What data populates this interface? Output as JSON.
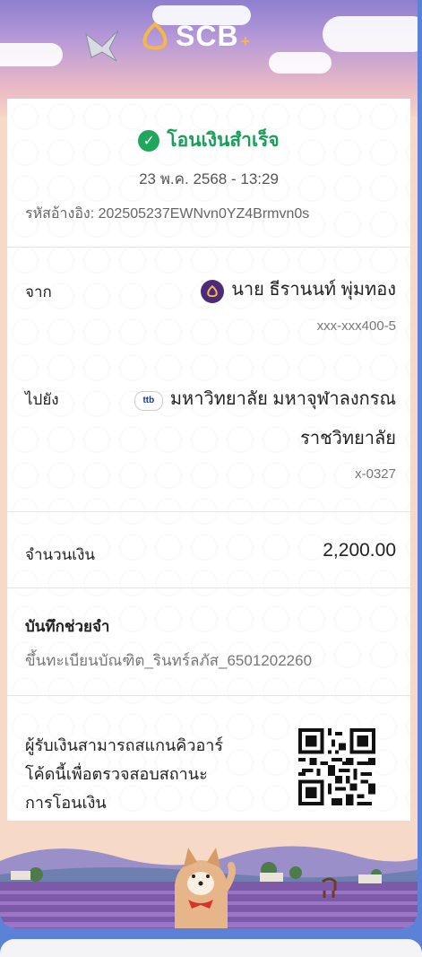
{
  "header": {
    "brand": "SCB",
    "brand_plus": "+",
    "icons": {
      "logo": "scb-logo-icon",
      "bird": "bird-illustration-icon"
    }
  },
  "status": {
    "text": "โอนเงินสำเร็จ",
    "icon": "check-circle-icon",
    "color": "#1fa75d"
  },
  "datetime": "23 พ.ค. 2568 - 13:29",
  "reference": "รหัสอ้างอิง: 202505237EWNvn0YZ4Brmvn0s",
  "from": {
    "label": "จาก",
    "name": "นาย ธีรานนท์ พุ่มทอง",
    "account": "xxx-xxx400-5",
    "bank_icon": "scb-bank-icon"
  },
  "to": {
    "label": "ไปยัง",
    "name_line1": "มหาวิทยาลัย มหาจุฬาลงกรณ",
    "name_line2": "ราชวิทยาลัย",
    "account": "x-0327",
    "bank_icon": "receiver-bank-icon"
  },
  "amount": {
    "label": "จำนวนเงิน",
    "value": "2,200.00"
  },
  "memo": {
    "label": "บันทึกช่วยจำ",
    "value": "ขึ้นทะเบียนบัณฑิต_รินทร์ลภัส_6501202260"
  },
  "qr": {
    "note_lines": [
      "ผู้รับเงินสามารถสแกนคิวอาร์",
      "โค้ดนี้เพื่อตรวจสอบสถานะ",
      "การโอนเงิน"
    ],
    "icon": "qr-code"
  },
  "colors": {
    "accent_purple": "#4b2b7a",
    "success": "#16a05a",
    "page_bg": "#5b82d6"
  }
}
